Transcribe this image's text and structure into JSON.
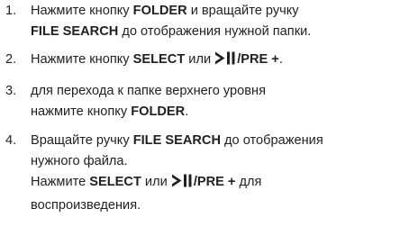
{
  "steps": [
    {
      "number": "1.",
      "line1_a": "Нажмите кнопку ",
      "line1_b": "FOLDER",
      "line1_c": " и вращайте ручку",
      "line2_a": "FILE SEARCH",
      "line2_b": " до отображения нужной папки."
    },
    {
      "number": "2.",
      "a": "Нажмите кнопку ",
      "b": "SELECT",
      "c": " или ",
      "d": "/PRE +",
      "e": "."
    },
    {
      "number": "3.",
      "line1": "для перехода к папке верхнего уровня",
      "line2_a": "нажмите кнопку ",
      "line2_b": "FOLDER",
      "line2_c": "."
    },
    {
      "number": "4.",
      "line1_a": "Вращайте ручку ",
      "line1_b": "FILE SEARCH",
      "line1_c": " до отображения",
      "line2": "нужного файла.",
      "line3_a": "Нажмите ",
      "line3_b": "SELECT",
      "line3_c": " или ",
      "line3_d": "/PRE +",
      "line3_e": " для",
      "line4": "воспроизведения."
    }
  ],
  "icons": {
    "play_pause": "play-pause-icon"
  }
}
